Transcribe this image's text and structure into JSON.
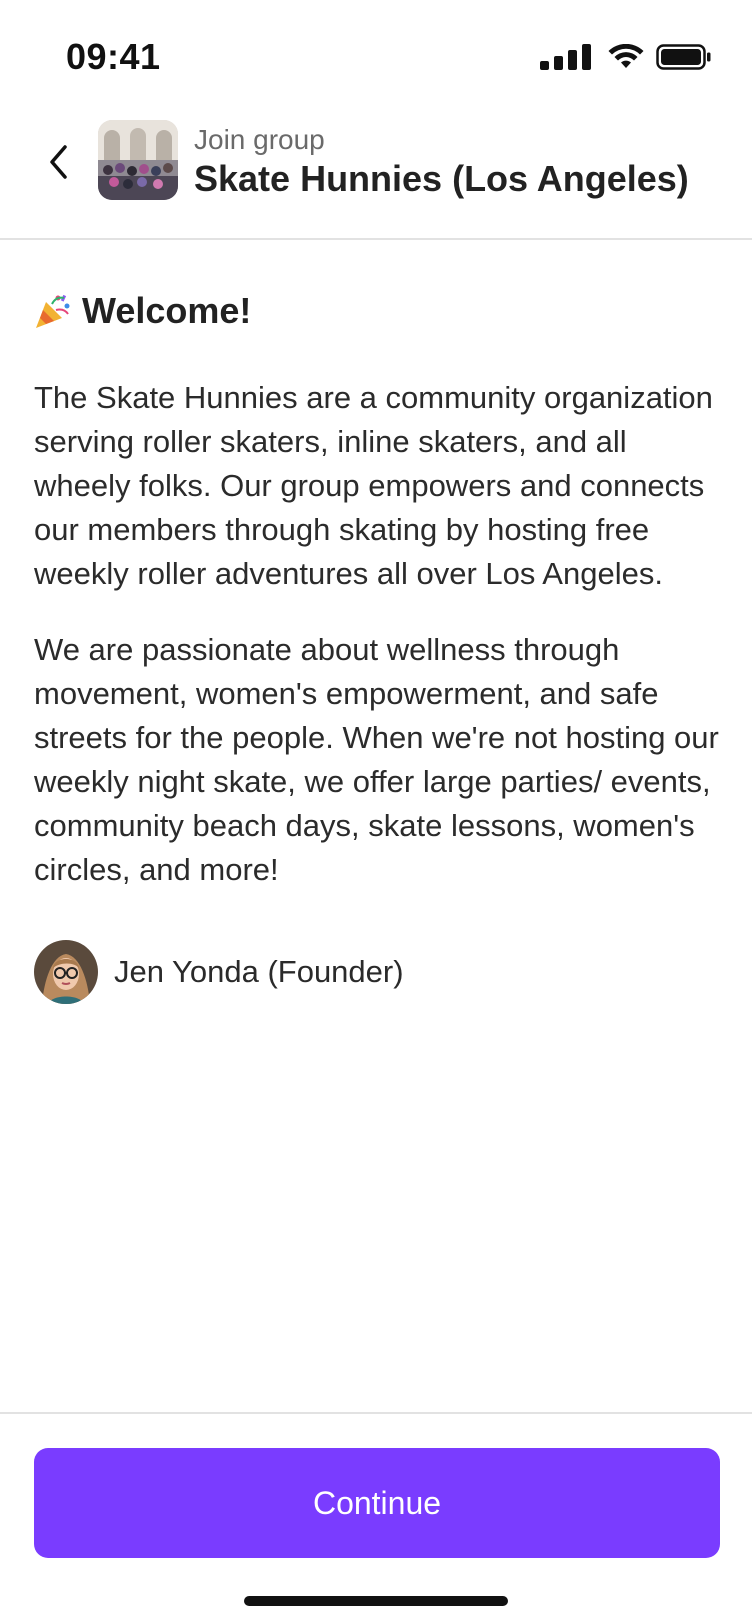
{
  "status_bar": {
    "time": "09:41",
    "icons": [
      "cellular-signal-icon",
      "wifi-icon",
      "battery-icon"
    ]
  },
  "header": {
    "subtitle": "Join group",
    "title": "Skate Hunnies (Los Angeles)",
    "back_icon": "chevron-left-icon"
  },
  "main": {
    "welcome_emoji": "party-popper-icon",
    "welcome_title": "Welcome!",
    "paragraphs": [
      "The Skate Hunnies are a community organization serving roller skaters, inline skaters, and all wheely folks. Our group empowers and connects our members through skating by hosting free weekly roller adventures all over Los Angeles.",
      "We are passionate about wellness through movement, women's empowerment, and safe streets for the people. When we're not hosting our weekly night skate, we offer large parties/ events, community beach days, skate lessons, women's circles, and more!"
    ],
    "founder": {
      "name": "Jen Yonda (Founder)"
    }
  },
  "footer": {
    "continue_label": "Continue"
  },
  "colors": {
    "accent": "#7a3cff",
    "divider": "#e2e2e2",
    "text": "#262626",
    "muted": "#6a6a6a"
  }
}
